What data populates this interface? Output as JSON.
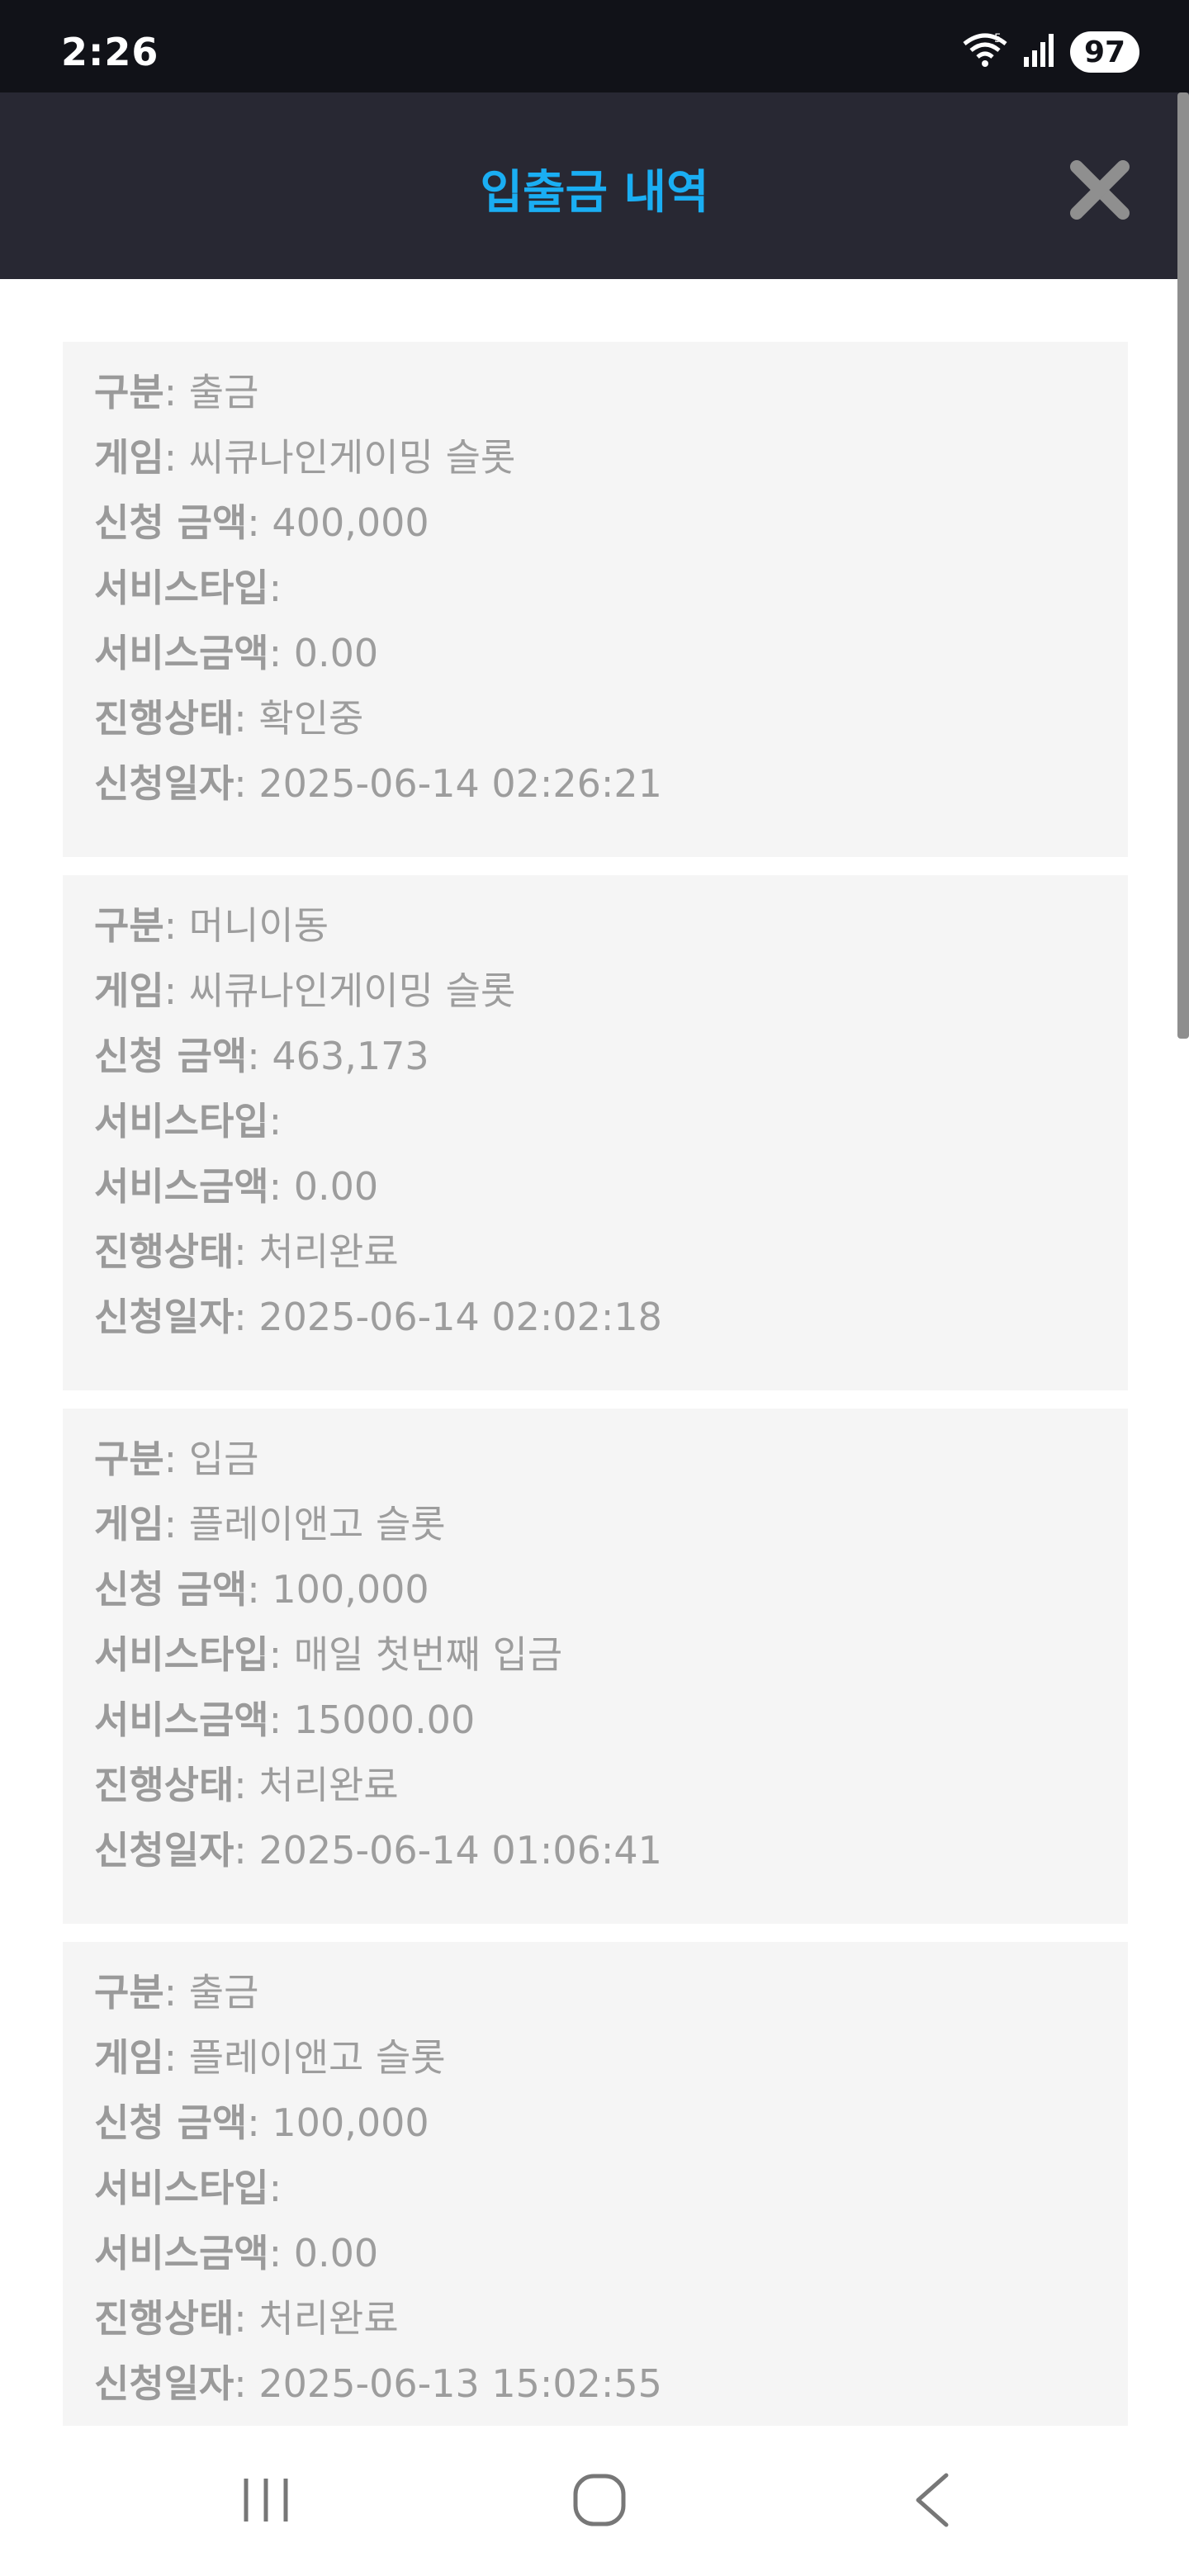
{
  "status_bar": {
    "time": "2:26",
    "battery": "97",
    "icons": [
      "wifi-icon",
      "signal-icon",
      "battery-icon"
    ]
  },
  "header": {
    "title": "입출금 내역",
    "close_icon": "close-icon",
    "title_color": "#1aaef3"
  },
  "transactions": [
    {
      "type_label": "구분",
      "type": ": 출금",
      "game_label": "게임",
      "game": ": 씨큐나인게이밍 슬롯",
      "amount_label": "신청 금액",
      "amount": ": 400,000",
      "service_type_label": "서비스타입",
      "service_type": ":",
      "service_amount_label": "서비스금액",
      "service_amount": ": 0.00",
      "status_label": "진행상태",
      "status": ": 확인중",
      "date_label": "신청일자",
      "date": ": 2025-06-14 02:26:21"
    },
    {
      "type_label": "구분",
      "type": ": 머니이동",
      "game_label": "게임",
      "game": ": 씨큐나인게이밍 슬롯",
      "amount_label": "신청 금액",
      "amount": ": 463,173",
      "service_type_label": "서비스타입",
      "service_type": ":",
      "service_amount_label": "서비스금액",
      "service_amount": ": 0.00",
      "status_label": "진행상태",
      "status": ": 처리완료",
      "date_label": "신청일자",
      "date": ": 2025-06-14 02:02:18"
    },
    {
      "type_label": "구분",
      "type": ": 입금",
      "game_label": "게임",
      "game": ": 플레이앤고 슬롯",
      "amount_label": "신청 금액",
      "amount": ": 100,000",
      "service_type_label": "서비스타입",
      "service_type": ": 매일 첫번째 입금",
      "service_amount_label": "서비스금액",
      "service_amount": ": 15000.00",
      "status_label": "진행상태",
      "status": ": 처리완료",
      "date_label": "신청일자",
      "date": ": 2025-06-14 01:06:41"
    },
    {
      "type_label": "구분",
      "type": ": 출금",
      "game_label": "게임",
      "game": ": 플레이앤고 슬롯",
      "amount_label": "신청 금액",
      "amount": ": 100,000",
      "service_type_label": "서비스타입",
      "service_type": ":",
      "service_amount_label": "서비스금액",
      "service_amount": ": 0.00",
      "status_label": "진행상태",
      "status": ": 처리완료",
      "date_label": "신청일자",
      "date": ": 2025-06-13 15:02:55"
    }
  ],
  "nav_bar": {
    "icons": [
      "recent-apps-icon",
      "home-icon",
      "back-icon"
    ]
  }
}
